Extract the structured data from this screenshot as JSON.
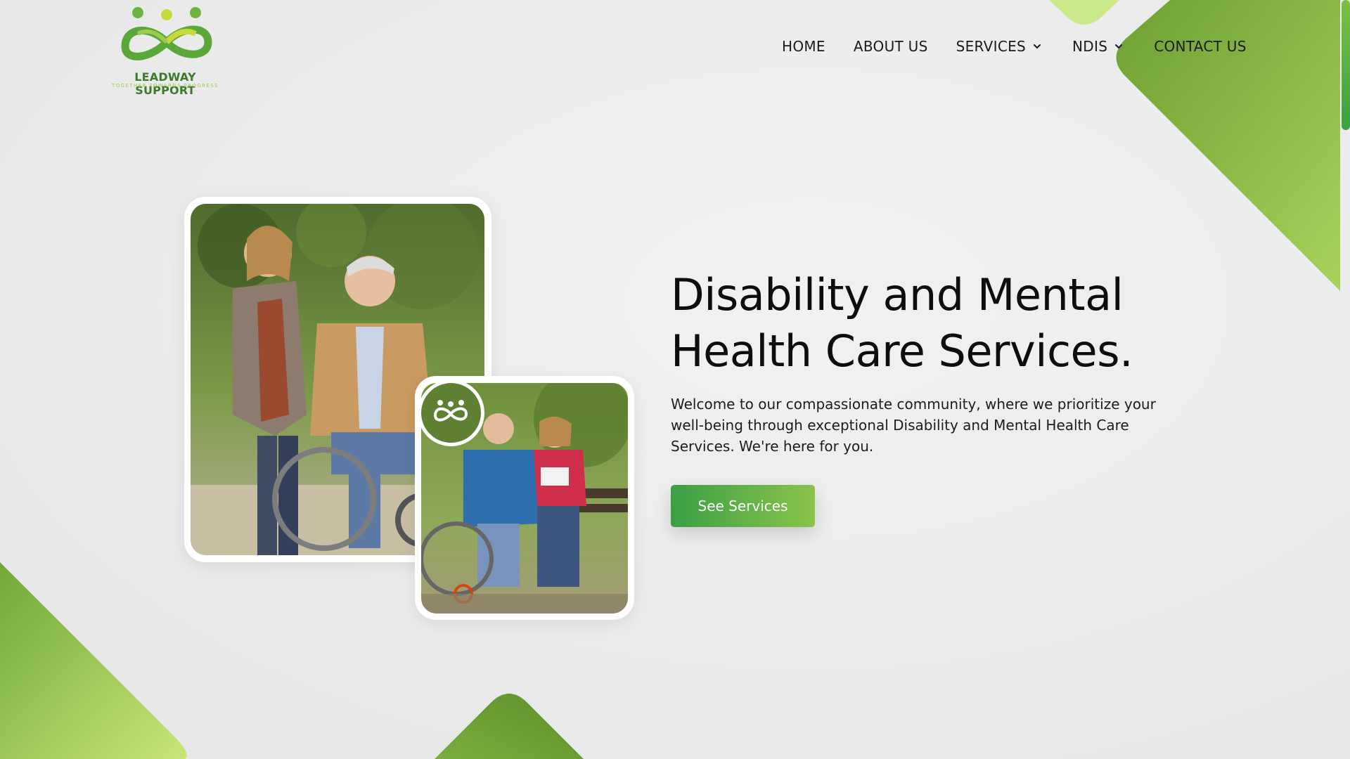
{
  "brand": {
    "name": "LEADWAY SUPPORT",
    "tagline": "TOGETHER TOWARDS PROGRESS",
    "icon": "three-figures-logo-icon"
  },
  "nav": {
    "items": [
      {
        "label": "HOME",
        "has_dropdown": false
      },
      {
        "label": "ABOUT US",
        "has_dropdown": false
      },
      {
        "label": "SERVICES",
        "has_dropdown": true
      },
      {
        "label": "NDIS",
        "has_dropdown": true
      },
      {
        "label": "CONTACT US",
        "has_dropdown": false
      }
    ],
    "dropdown_icon": "chevron-down-icon"
  },
  "hero": {
    "title_line1": "Disability and Mental",
    "title_line2": "Health Care Services.",
    "description": "Welcome to our compassionate community, where we prioritize your well-being through exceptional Disability and Mental Health Care Services. We're here for you.",
    "cta_label": "See Services"
  },
  "colors": {
    "accent_green": "#3a9f45",
    "light_green": "#c5e478",
    "dark_green": "#6a9f35"
  }
}
